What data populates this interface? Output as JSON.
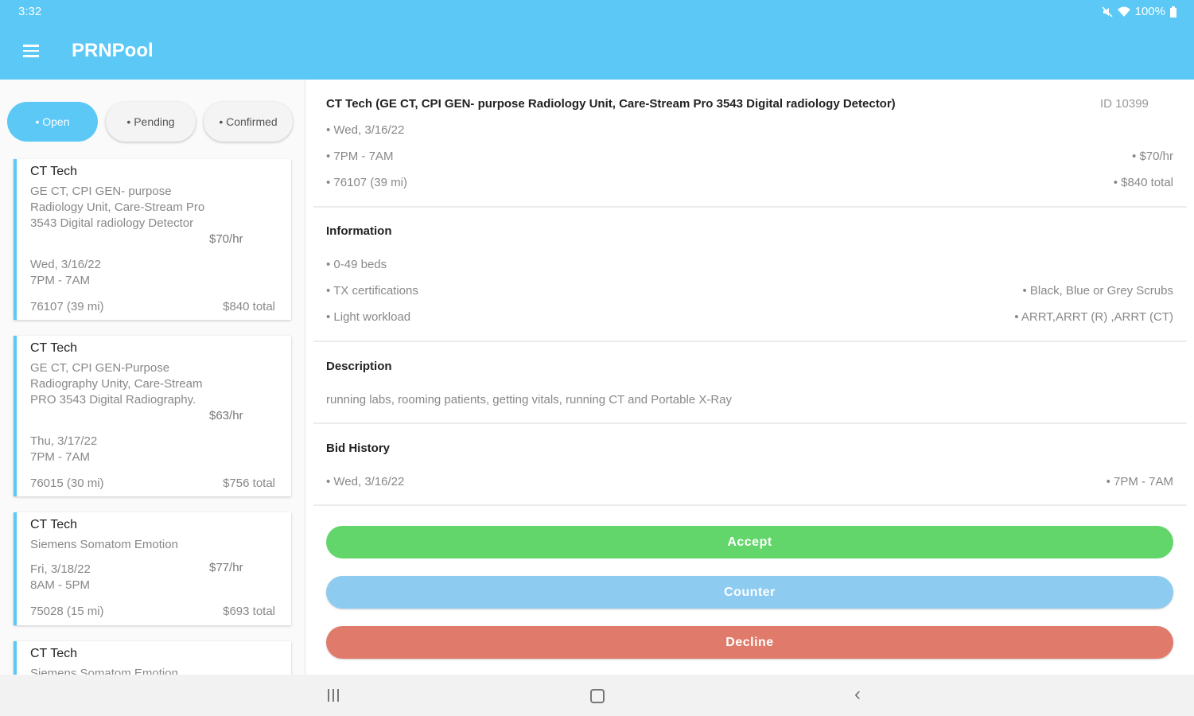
{
  "status_bar": {
    "time": "3:32",
    "battery": "100%"
  },
  "app": {
    "title": "PRNPool"
  },
  "colors": {
    "primary": "#5bc8f5",
    "accept": "#62d66b",
    "counter": "#8ecbf0",
    "decline": "#e07b6b"
  },
  "tabs": [
    {
      "label": "• Open"
    },
    {
      "label": "• Pending"
    },
    {
      "label": "• Confirmed"
    }
  ],
  "jobs": [
    {
      "title": "CT Tech",
      "description": "GE CT, CPI GEN- purpose Radiology Unit, Care-Stream Pro 3543 Digital radiology Detector",
      "rate": "$70/hr",
      "date": "Wed, 3/16/22",
      "time": "7PM - 7AM",
      "zip": "76107 (39 mi)",
      "total": "$840 total"
    },
    {
      "title": "CT Tech",
      "description": "GE CT, CPI GEN-Purpose Radiography Unity, Care-Stream PRO 3543 Digital Radiography.",
      "rate": "$63/hr",
      "date": "Thu, 3/17/22",
      "time": "7PM - 7AM",
      "zip": "76015 (30 mi)",
      "total": "$756 total"
    },
    {
      "title": "CT Tech",
      "description": "Siemens Somatom Emotion",
      "rate": "$77/hr",
      "date": "Fri, 3/18/22",
      "time": "8AM - 5PM",
      "zip": "75028 (15 mi)",
      "total": "$693 total"
    },
    {
      "title": "CT Tech",
      "description": "Siemens Somatom Emotion"
    }
  ],
  "detail": {
    "title": "CT Tech (GE CT, CPI GEN- purpose Radiology Unit, Care-Stream Pro 3543 Digital radiology Detector)",
    "id": "ID 10399",
    "date": "• Wed, 3/16/22",
    "time": "• 7PM - 7AM",
    "rate": "• $70/hr",
    "location": "• 76107 (39 mi)",
    "total": "• $840 total",
    "information": {
      "heading": "Information",
      "left": [
        "• 0-49 beds",
        "• TX certifications",
        "• Light workload"
      ],
      "right": [
        "• Black, Blue or Grey Scrubs",
        "• ARRT,ARRT (R) ,ARRT (CT)"
      ]
    },
    "description": {
      "heading": "Description",
      "text": "running labs, rooming patients, getting vitals, running CT and Portable X-Ray"
    },
    "bid_history": {
      "heading": "Bid History",
      "date": "• Wed, 3/16/22",
      "time": "• 7PM - 7AM"
    }
  },
  "actions": {
    "accept": "Accept",
    "counter": "Counter",
    "decline": "Decline"
  }
}
